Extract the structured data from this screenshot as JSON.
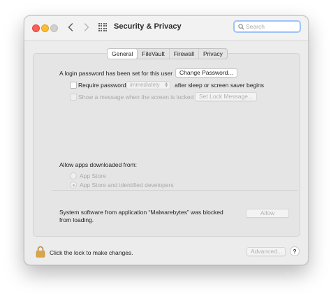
{
  "window": {
    "title": "Security & Privacy"
  },
  "search": {
    "placeholder": "Search",
    "value": ""
  },
  "tabs": [
    {
      "label": "General",
      "selected": true
    },
    {
      "label": "FileVault",
      "selected": false
    },
    {
      "label": "Firewall",
      "selected": false
    },
    {
      "label": "Privacy",
      "selected": false
    }
  ],
  "general": {
    "login_password_text": "A login password has been set for this user",
    "change_password_button": "Change Password...",
    "require_password_label": "Require password",
    "require_password_value": "immediately",
    "require_password_suffix": "after sleep or screen saver begins",
    "show_message_label": "Show a message when the screen is locked",
    "set_lock_message_button": "Set Lock Message...",
    "allow_apps_heading": "Allow apps downloaded from:",
    "allow_options": [
      {
        "label": "App Store",
        "selected": false
      },
      {
        "label": "App Store and identified developers",
        "selected": true
      }
    ],
    "blocked_message": "System software from application “Malwarebytes” was blocked from loading.",
    "allow_button": "Allow"
  },
  "footer": {
    "lock_text": "Click the lock to make changes.",
    "advanced_button": "Advanced...",
    "help_button": "?"
  },
  "colors": {
    "search_focus_ring": "#9ec3f5",
    "close_light": "#fe5f57",
    "minimize_light": "#febc2e",
    "lock_icon": "#d8a64a"
  }
}
